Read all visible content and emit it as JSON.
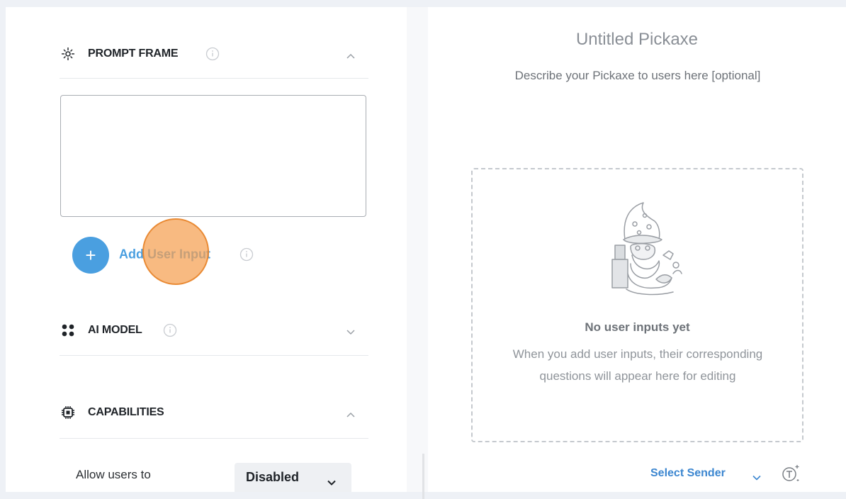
{
  "left_panel": {
    "prompt_frame": {
      "title": "PROMPT FRAME",
      "icon": "target-icon",
      "expanded": true
    },
    "prompt_textarea": {
      "value": ""
    },
    "add_user_input": {
      "label": "Add User Input",
      "icon": "plus-icon"
    },
    "ai_model": {
      "title": "AI MODEL",
      "icon": "apps-icon",
      "expanded": false
    },
    "capabilities": {
      "title": "CAPABILITIES",
      "icon": "chip-icon",
      "expanded": true
    },
    "allow_users": {
      "label": "Allow users to",
      "select_value": "Disabled"
    }
  },
  "preview": {
    "title": "Untitled Pickaxe",
    "description": "Describe your Pickaxe to users here [optional]",
    "empty_state": {
      "title": "No user inputs yet",
      "body": "When you add user inputs, their corresponding questions will appear here for editing"
    },
    "sender": {
      "label": "Select Sender"
    }
  },
  "colors": {
    "accent": "#4a9fe0",
    "link": "#3b86d0",
    "cursor": "#f5a050",
    "background": "#eef1f6"
  }
}
